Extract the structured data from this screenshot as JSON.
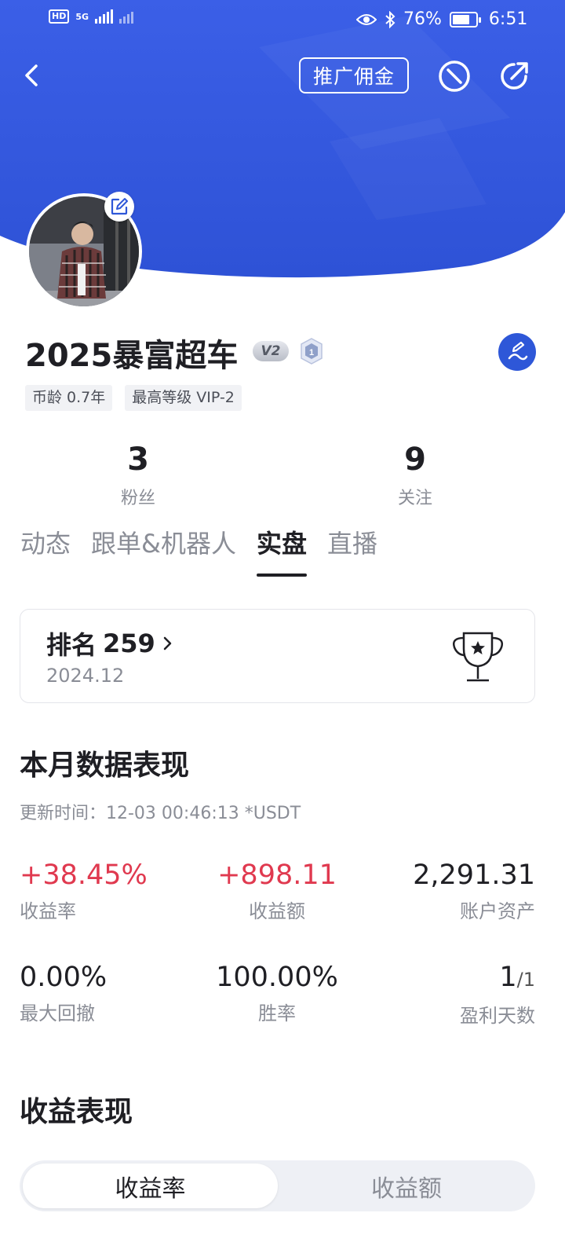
{
  "status_bar": {
    "network_badge": "HD",
    "network_type": "5G",
    "battery_percent": "76%",
    "battery_level": 0.76,
    "time": "6:51"
  },
  "header": {
    "promo_label": "推广佣金",
    "colors": {
      "primary": "#2e57d8",
      "header_top": "#3a5ee6"
    }
  },
  "profile": {
    "username": "2025暴富超车",
    "vip_badge": "V2",
    "level_badge": "1",
    "tags": [
      "币龄 0.7年",
      "最高等级 VIP-2"
    ]
  },
  "stats": {
    "followers": {
      "value": "3",
      "label": "粉丝"
    },
    "following": {
      "value": "9",
      "label": "关注"
    }
  },
  "tabs": [
    {
      "label": "动态",
      "active": false
    },
    {
      "label": "跟单&机器人",
      "active": false
    },
    {
      "label": "实盘",
      "active": true
    },
    {
      "label": "直播",
      "active": false
    }
  ],
  "rank_card": {
    "label": "排名",
    "rank": "259",
    "period": "2024.12"
  },
  "monthly": {
    "title": "本月数据表现",
    "updated": "更新时间：12-03 00:46:13  *USDT",
    "metrics": [
      {
        "value": "+38.45%",
        "label": "收益率"
      },
      {
        "value": "+898.11",
        "label": "收益额"
      },
      {
        "value": "2,291.31",
        "label": "账户资产"
      },
      {
        "value": "0.00%",
        "label": "最大回撤"
      },
      {
        "value": "100.00%",
        "label": "胜率"
      },
      {
        "value": "1",
        "value_suffix": "/1",
        "label": "盈利天数"
      }
    ],
    "colors": {
      "positive": "#e0394f"
    }
  },
  "performance": {
    "title": "收益表现",
    "toggle": [
      "收益率",
      "收益额"
    ]
  }
}
